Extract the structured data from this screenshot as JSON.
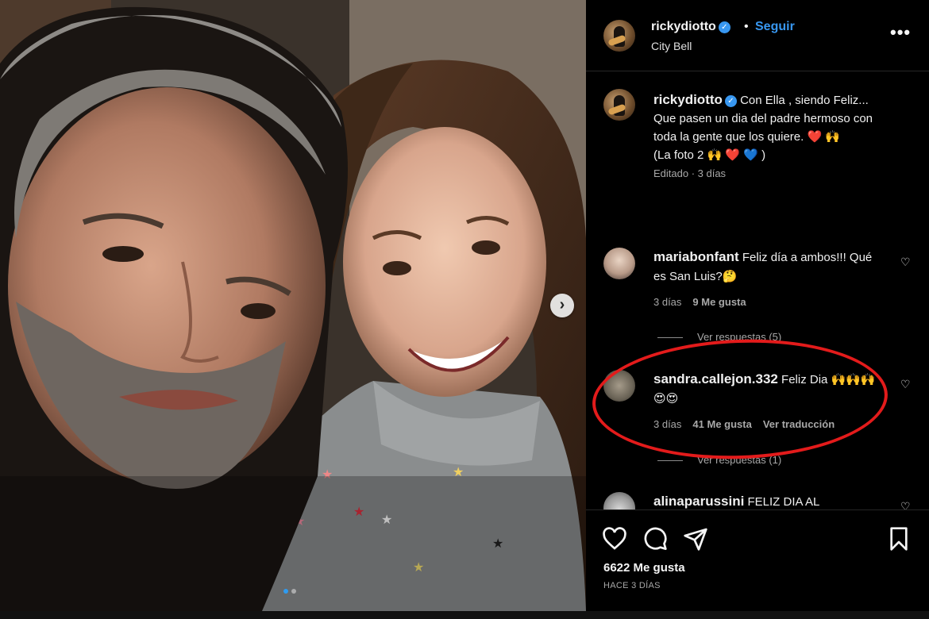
{
  "post": {
    "username": "rickydiotto",
    "verified_mark": "✓",
    "separator": "•",
    "follow_label": "Seguir",
    "location": "City Bell",
    "more_label": "•••",
    "carousel": {
      "next_glyph": "›",
      "slides": 2,
      "current": 1
    }
  },
  "caption": {
    "username": "rickydiotto",
    "text": " Con Ella , siendo Feliz...",
    "line2": "Que pasen un dia del padre hermoso con toda la gente que los quiere. ❤️ 🙌",
    "line3": "(La foto 2 🙌 ❤️ 💙 )",
    "meta": "Editado · 3 días"
  },
  "comments": [
    {
      "username": "mariabonfant",
      "text": " Feliz día a ambos!!! Qué es San Luis?🤔",
      "time": "3 días",
      "likes": "9 Me gusta",
      "replies": "Ver respuestas (5)"
    },
    {
      "username": "sandra.callejon.332",
      "text": " Feliz Dia 🙌🙌🙌😍😍",
      "time": "3 días",
      "likes": "41 Me gusta",
      "translate": "Ver traducción",
      "replies": "Ver respuestas (1)"
    },
    {
      "username": "alinaparussini",
      "text": " FELIZ DIA AL"
    }
  ],
  "footer": {
    "likes": "6622 Me gusta",
    "ago": "HACE 3 DÍAS"
  },
  "colors": {
    "accent": "#3897f0",
    "highlight": "#e31b1b",
    "background": "#000000"
  }
}
